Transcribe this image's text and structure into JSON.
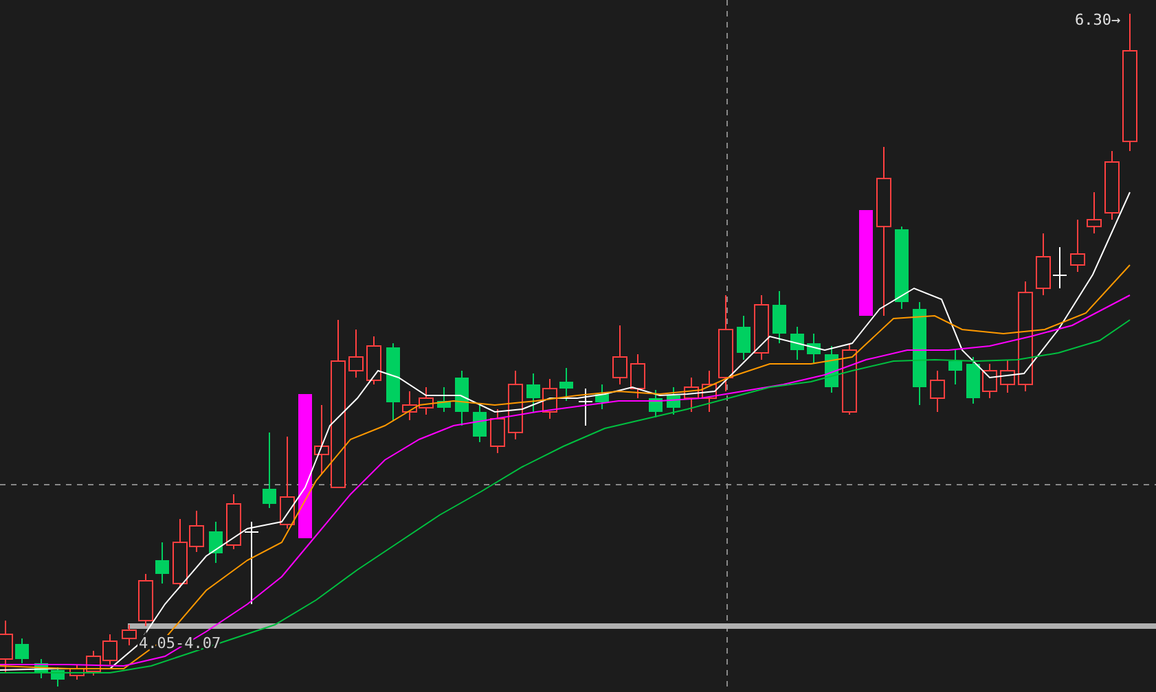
{
  "chart": {
    "high_label": "6.30→",
    "range_label": "4.05-4.07"
  }
}
